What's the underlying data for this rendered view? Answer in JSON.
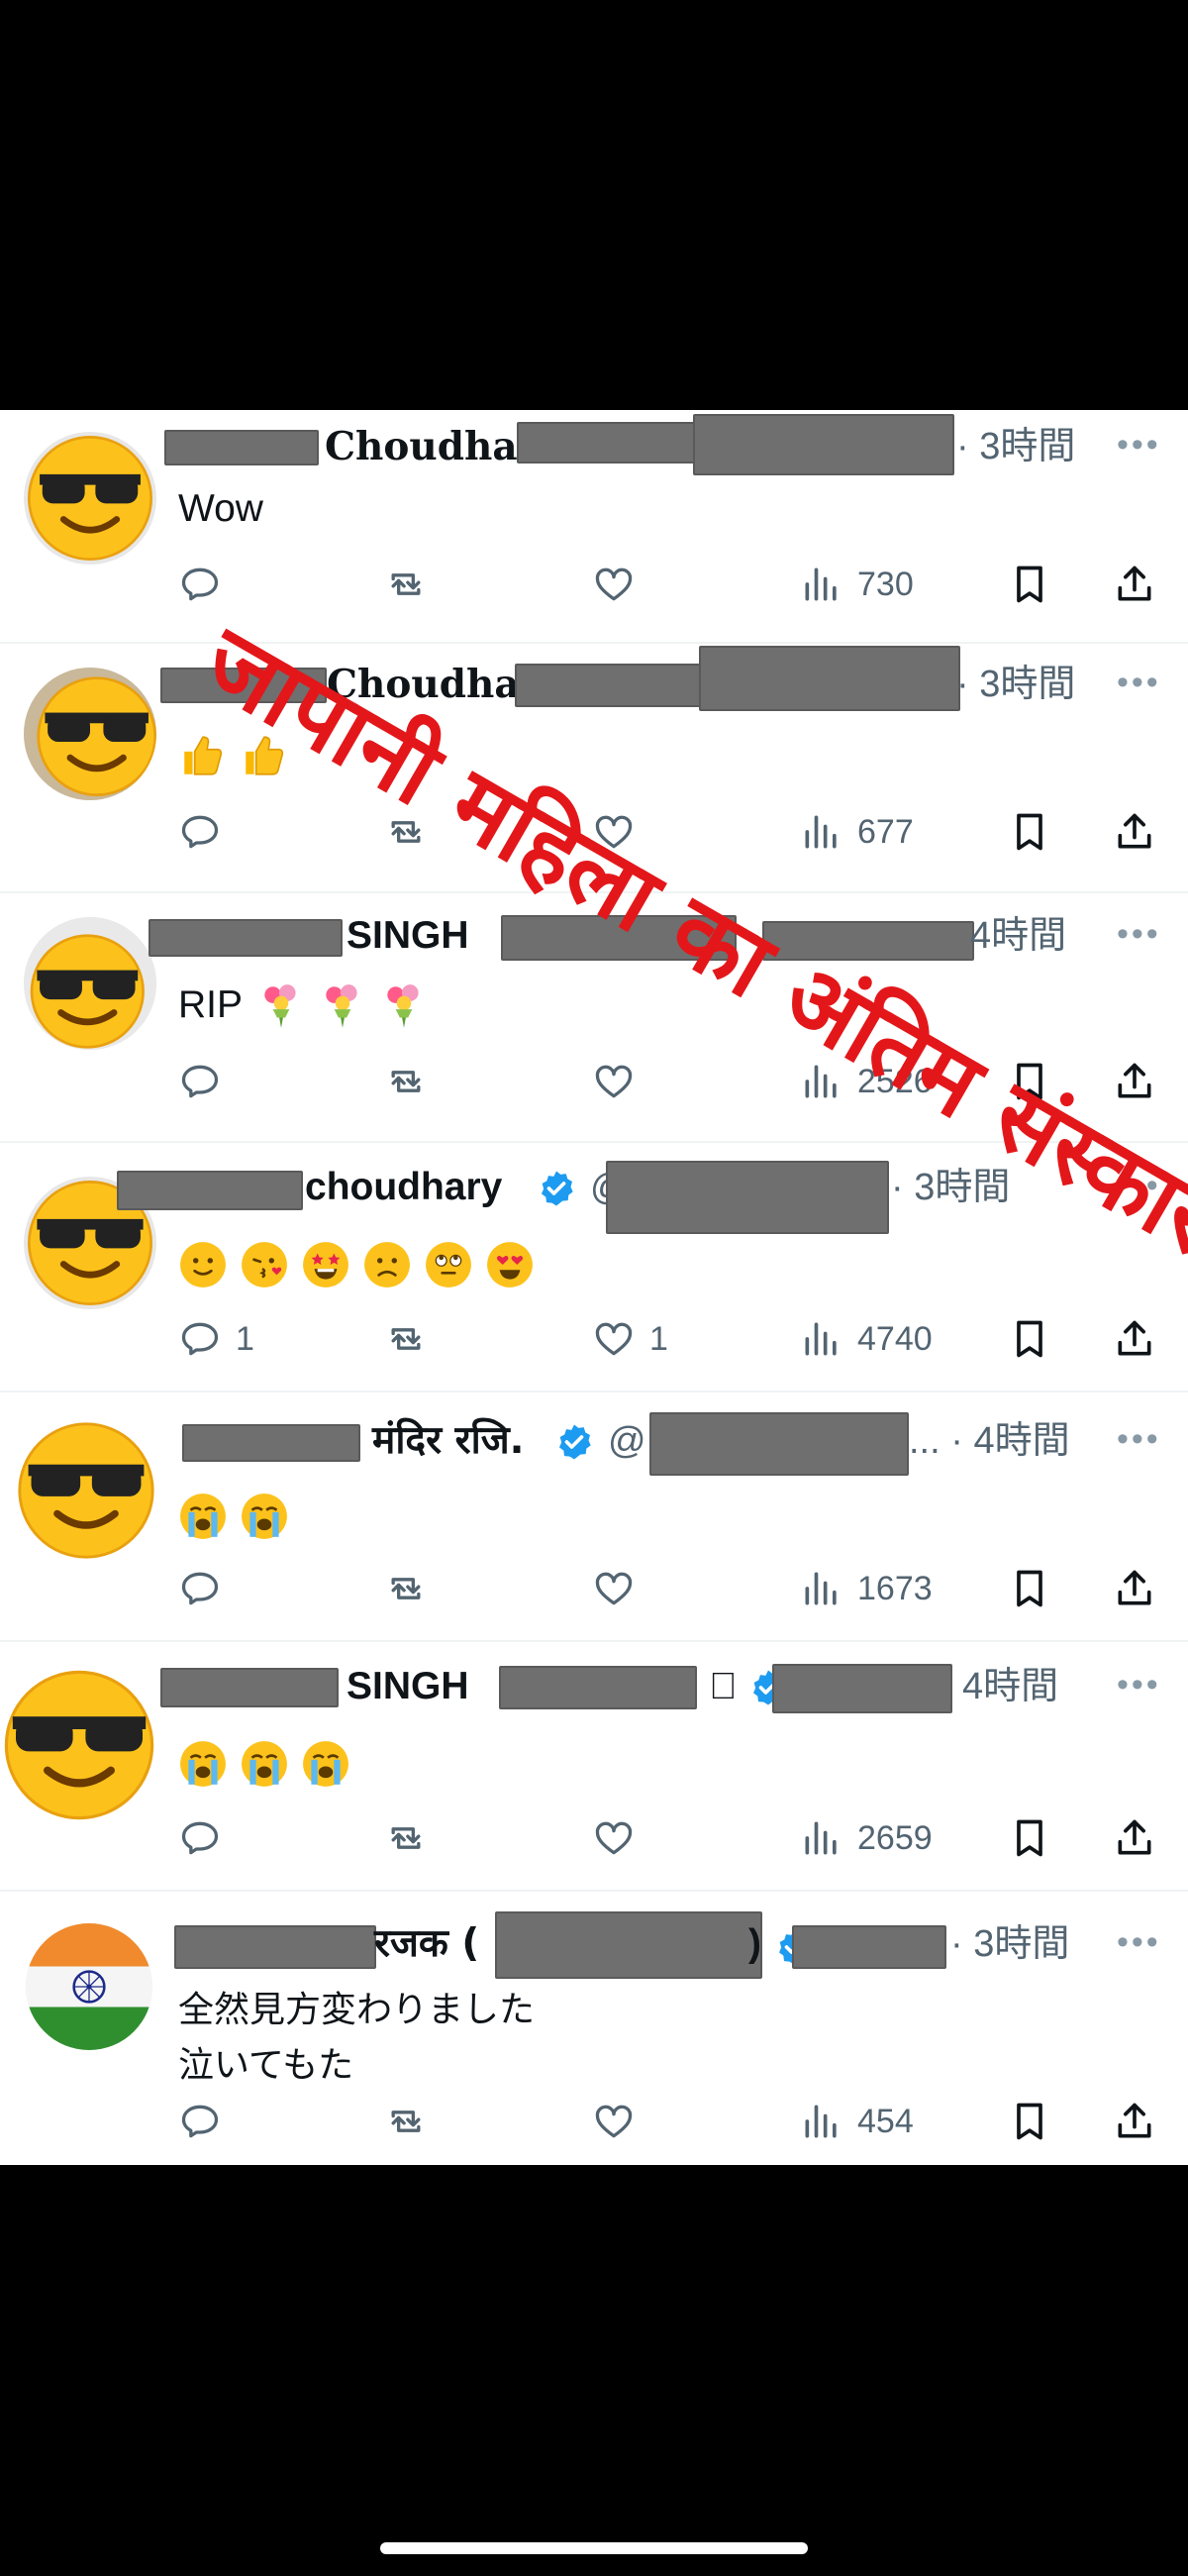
{
  "watermark": "जापानी महिला का अंतिम संस्कार पोस्ट",
  "tweets": [
    {
      "name_fragment": "Choudha",
      "time": "· 3時間",
      "text": "Wow",
      "avatar": "sunglasses-emoji",
      "reply_count": "",
      "like_count": "",
      "views": "730"
    },
    {
      "name_fragment": "Choudha",
      "time": "· 3時間",
      "text": "👍👍",
      "avatar": "sunglasses-emoji",
      "reply_count": "",
      "like_count": "",
      "views": "677"
    },
    {
      "name_fragment": "SINGH",
      "time": "4時間",
      "text": "RIP 💐💐💐",
      "avatar": "sunglasses-emoji",
      "reply_count": "",
      "like_count": "",
      "views": "2526"
    },
    {
      "name_fragment": "choudhary",
      "handle_fragment": "@",
      "time": "· 3時間",
      "text": "🙂😘🤩😟🙄😍",
      "avatar": "sunglasses-emoji",
      "reply_count": "1",
      "like_count": "1",
      "views": "4740"
    },
    {
      "name_fragment": "मंदिर रजि.",
      "handle_fragment": "@",
      "time": "... · 4時間",
      "text": "😭😭",
      "avatar": "sunglasses-emoji",
      "reply_count": "",
      "like_count": "",
      "views": "1673"
    },
    {
      "name_fragment": "SINGH",
      "time": "4時間",
      "text": "😭😭😭",
      "avatar": "sunglasses-emoji",
      "reply_count": "",
      "like_count": "",
      "views": "2659"
    },
    {
      "name_fragment": "रजक (",
      "name_suffix": ")",
      "time": "· 3時間",
      "text": "全然見方変わりました\n泣いてもた",
      "avatar": "india-flag",
      "reply_count": "",
      "like_count": "",
      "views": "454"
    }
  ],
  "icons": {
    "reply": "reply-icon",
    "retweet": "retweet-icon",
    "like": "like-icon",
    "views": "views-icon",
    "bookmark": "bookmark-icon",
    "share": "share-icon",
    "more": "more-icon",
    "verified": "verified-badge-icon"
  },
  "colors": {
    "watermark": "#e3171a",
    "verified": "#1d9bf0",
    "meta": "#536471",
    "text": "#0f1419"
  }
}
